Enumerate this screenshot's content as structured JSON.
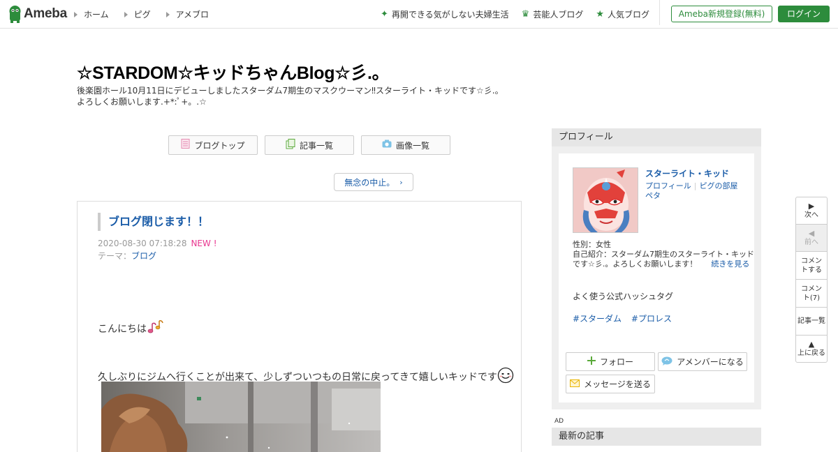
{
  "header": {
    "logo_text": "Ameba",
    "nav_left": [
      "ホーム",
      "ピグ",
      "アメブロ"
    ],
    "nav_right": [
      {
        "label": "再開できる気がしない夫婦生活",
        "icon": "sparkle-icon"
      },
      {
        "label": "芸能人ブログ",
        "icon": "crown-icon"
      },
      {
        "label": "人気ブログ",
        "icon": "star-icon"
      }
    ],
    "register_label": "Ameba新規登録(無料)",
    "login_label": "ログイン",
    "brand_color": "#2d8c3c"
  },
  "blog": {
    "title": "☆STARDOM☆キッドちゃんBlog☆彡.。",
    "description_line1": "後楽園ホール10月11日にデビューしましたスターダム7期生のマスクウーマン‼︎スターライト・キッドです☆彡.。",
    "description_line2": "よろしくお願いします.+*:ﾟ+。.☆"
  },
  "blog_nav": {
    "top_label": "ブログトップ",
    "articles_label": "記事一覧",
    "images_label": "画像一覧"
  },
  "prev_article_label": "無念の中止。",
  "article": {
    "title": "ブログ閉じます！！",
    "date": "2020-08-30 07:18:28",
    "new_badge": "NEW !",
    "theme_prefix": "テーマ：",
    "theme": "ブログ",
    "p1": "こんにちは",
    "p2": "久しぶりにジムへ行くことが出来て、少しずついつもの日常に戻ってきて嬉しいキッドです"
  },
  "sidebar": {
    "profile_header": "プロフィール",
    "name": "スターライト・キッド",
    "link_profile": "プロフィール",
    "link_pig_room": "ピグの部屋",
    "link_peta": "ペタ",
    "gender": "性別：女性",
    "intro": "自己紹介：スターダム7期生のスターライト・キッドです☆彡.。よろしくお願いします！",
    "more_label": "続きを見る",
    "hashtag_header": "よく使う公式ハッシュタグ",
    "hashtags": [
      "#スターダム",
      "#プロレス"
    ],
    "follow_label": "フォロー",
    "amember_label": "アメンバーになる",
    "message_label": "メッセージを送る",
    "ad_label": "AD",
    "latest_header": "最新の記事"
  },
  "float_tool": {
    "next": "次へ",
    "prev": "前へ",
    "comment_do": "コメントする",
    "comment_count": "コメント(7)",
    "articles": "記事一覧",
    "to_top": "上に戻る"
  }
}
